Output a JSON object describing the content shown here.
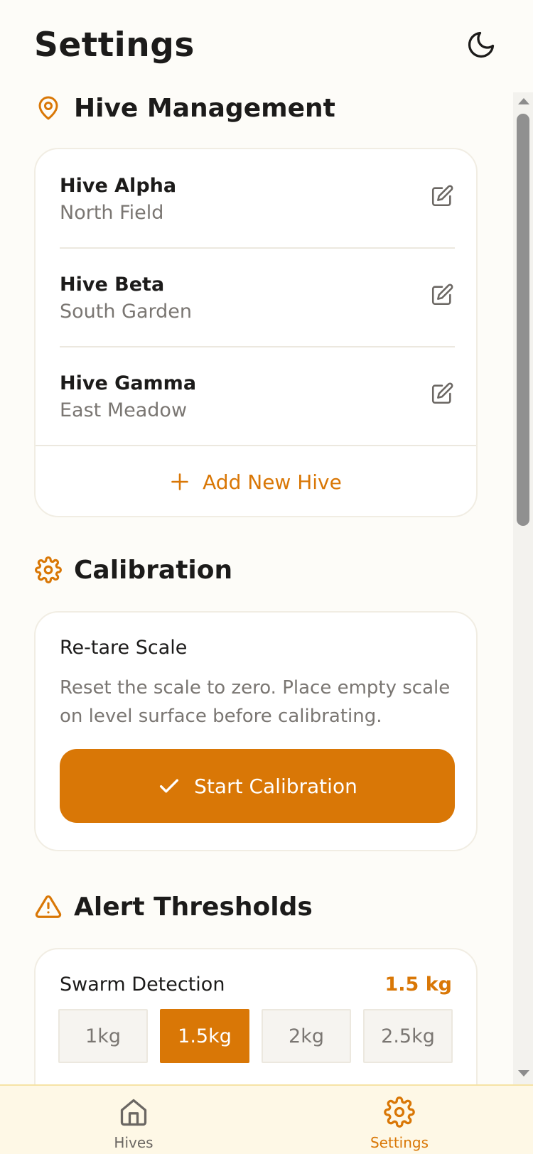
{
  "header": {
    "title": "Settings",
    "theme_icon": "moon-icon"
  },
  "hive_management": {
    "title": "Hive Management",
    "icon": "map-pin-icon",
    "hives": [
      {
        "name": "Hive Alpha",
        "location": "North Field"
      },
      {
        "name": "Hive Beta",
        "location": "South Garden"
      },
      {
        "name": "Hive Gamma",
        "location": "East Meadow"
      }
    ],
    "add_label": "Add New Hive"
  },
  "calibration": {
    "title": "Calibration",
    "icon": "gear-icon",
    "item_title": "Re-tare Scale",
    "description": "Reset the scale to zero. Place empty scale on level surface before calibrating.",
    "button_label": "Start Calibration"
  },
  "alert_thresholds": {
    "title": "Alert Thresholds",
    "icon": "warning-icon",
    "swarm": {
      "label": "Swarm Detection",
      "value": "1.5 kg",
      "options": [
        "1kg",
        "1.5kg",
        "2kg",
        "2.5kg"
      ],
      "selected": "1.5kg"
    }
  },
  "bottom_nav": {
    "items": [
      {
        "label": "Hives",
        "icon": "home-icon",
        "active": false
      },
      {
        "label": "Settings",
        "icon": "gear-icon",
        "active": true
      }
    ]
  },
  "colors": {
    "accent": "#d97706",
    "background": "#fdfcf8",
    "muted_text": "#7a7672",
    "nav_background": "#fef8e6"
  }
}
